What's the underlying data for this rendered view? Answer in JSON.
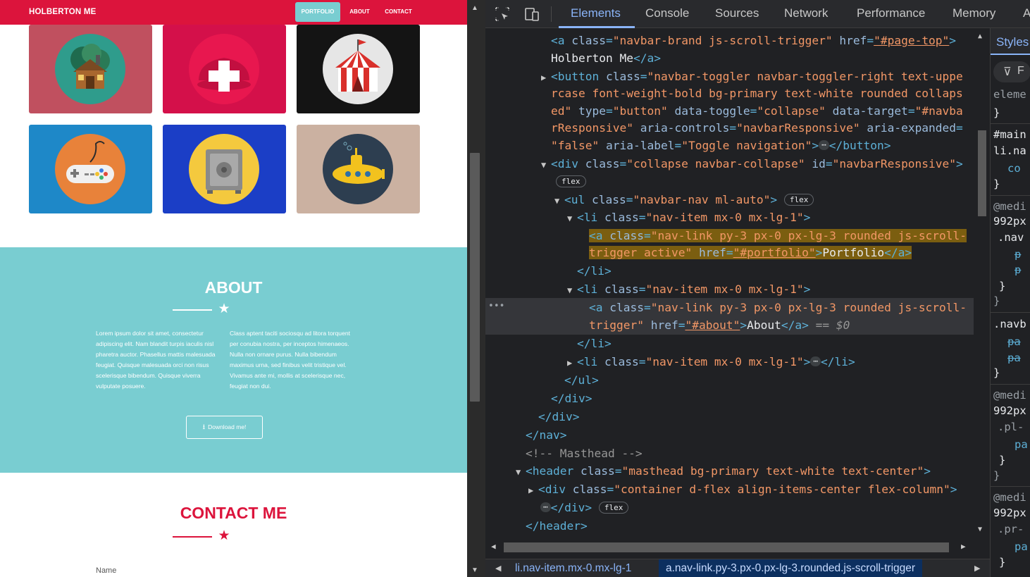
{
  "site": {
    "brand": "HOLBERTON ME",
    "nav": {
      "portfolio": "PORTFOLIO",
      "about": "ABOUT",
      "contact": "CONTACT"
    },
    "portfolio_items": [
      {
        "icon": "cabin-icon",
        "bg": "#c0505f"
      },
      {
        "icon": "cake-icon",
        "bg": "#d4104a"
      },
      {
        "icon": "circus-tent-icon",
        "bg": "#141414"
      },
      {
        "icon": "game-controller-icon",
        "bg": "#1e88c8"
      },
      {
        "icon": "safe-icon",
        "bg": "#1b3ec6"
      },
      {
        "icon": "submarine-icon",
        "bg": "#cbb1a1"
      }
    ],
    "about": {
      "title": "ABOUT",
      "col1": "Lorem ipsum dolor sit amet, consectetur adipiscing elit. Nam blandit turpis iaculis nisl pharetra auctor. Phasellus mattis malesuada feugiat. Quisque malesuada orci non risus scelerisque bibendum. Quisque viverra vulputate posuere.",
      "col2": "Class aptent taciti sociosqu ad litora torquent per conubia nostra, per inceptos himenaeos. Nulla non ornare purus. Nulla bibendum maximus urna, sed finibus velit tristique vel. Vivamus ante mi, mollis at scelerisque nec, feugiat non dui.",
      "download": "Download me!"
    },
    "contact": {
      "title": "CONTACT ME",
      "name_label": "Name"
    },
    "colors": {
      "primary": "#dc143c",
      "secondary": "#79cdd1"
    }
  },
  "devtools": {
    "tabs": [
      "Elements",
      "Console",
      "Sources",
      "Network",
      "Performance",
      "Memory",
      "A"
    ],
    "active_tab": "Elements",
    "breadcrumbs": [
      "li.nav-item.mx-0.mx-lg-1",
      "a.nav-link.py-3.px-0.px-lg-3.rounded.js-scroll-trigger"
    ],
    "styles_tab": "Styles",
    "styles_filter": "F",
    "styles_lines": [
      "eleme",
      "}",
      "#main",
      "li.na",
      "co",
      "}",
      "@medi",
      "992px",
      ".nav",
      "p",
      "p",
      "}",
      "}",
      ".navb",
      "pa",
      "pa",
      "}",
      "@medi",
      "992px",
      ".pl-",
      "pa",
      "}",
      "}",
      "@medi",
      "992px",
      ".pr-",
      "pa",
      "}"
    ],
    "dom": {
      "l1": {
        "tag_open": "<a ",
        "a1": "class",
        "v1": "\"navbar-brand js-scroll-trigger\"",
        "a2": "href",
        "v2": "\"#page-top\"",
        "end": ">"
      },
      "l2": {
        "text": "Holberton Me",
        "close": "</a>"
      },
      "l3": {
        "tag": "<button ",
        "a1": "class",
        "v1": "\"navbar-toggler navbar-toggler-right text-uppe"
      },
      "l4": {
        "cont": "rcase font-weight-bold bg-primary text-white rounded collaps"
      },
      "l5": {
        "cont": "ed\"",
        "a2": "type",
        "v2": "\"button\"",
        "a3": "data-toggle",
        "v3": "\"collapse\"",
        "a4": "data-target",
        "v4": "\"#navba"
      },
      "l6": {
        "cont": "rResponsive\"",
        "a5": "aria-controls",
        "v5": "\"navbarResponsive\"",
        "a6": "aria-expanded"
      },
      "l7": {
        "v6": "\"false\"",
        "a7": "aria-label",
        "v7": "\"Toggle navigation\"",
        "ell": "⋯",
        "close": "</button>"
      },
      "l8": {
        "tag": "<div ",
        "a1": "class",
        "v1": "\"collapse navbar-collapse\"",
        "a2": "id",
        "v2": "\"navbarResponsive\"",
        "end": ">"
      },
      "l9": {
        "pill": "flex"
      },
      "l10": {
        "tag": "<ul ",
        "a1": "class",
        "v1": "\"navbar-nav ml-auto\"",
        "end": ">",
        "pill": "flex"
      },
      "l11": {
        "tag": "<li ",
        "a1": "class",
        "v1": "\"nav-item mx-0 mx-lg-1\"",
        "end": ">"
      },
      "l12": {
        "tag": "<a ",
        "a1": "class",
        "v1": "\"nav-link py-3 px-0 px-lg-3 rounded js-scroll-"
      },
      "l13": {
        "cont": "trigger active\"",
        "a2": "href",
        "v2": "\"#portfolio\"",
        "text": "Portfolio",
        "close": "</a>"
      },
      "l14": {
        "close": "</li>"
      },
      "l15": {
        "tag": "<li ",
        "a1": "class",
        "v1": "\"nav-item mx-0 mx-lg-1\"",
        "end": ">"
      },
      "l16": {
        "tag": "<a ",
        "a1": "class",
        "v1": "\"nav-link py-3 px-0 px-lg-3 rounded js-scroll-"
      },
      "l17": {
        "cont": "trigger\"",
        "a2": "href",
        "v2": "\"#about\"",
        "text": "About",
        "close": "</a>",
        "eq": " == $0"
      },
      "l18": {
        "close": "</li>"
      },
      "l19": {
        "tag": "<li ",
        "a1": "class",
        "v1": "\"nav-item mx-0 mx-lg-1\"",
        "ell": "⋯",
        "close": "</li>"
      },
      "l20": {
        "close": "</ul>"
      },
      "l21": {
        "close": "</div>"
      },
      "l22": {
        "close": "</div>"
      },
      "l23": {
        "close": "</nav>"
      },
      "l24": {
        "comment": "<!-- Masthead -->"
      },
      "l25": {
        "tag": "<header ",
        "a1": "class",
        "v1": "\"masthead bg-primary text-white text-center\"",
        "end": ">"
      },
      "l26": {
        "tag": "<div ",
        "a1": "class",
        "v1": "\"container d-flex align-items-center flex-column\"",
        "end": ">"
      },
      "l27": {
        "ell": "⋯",
        "close": "</div>",
        "pill": "flex"
      },
      "l28": {
        "close": "</header>"
      }
    }
  }
}
